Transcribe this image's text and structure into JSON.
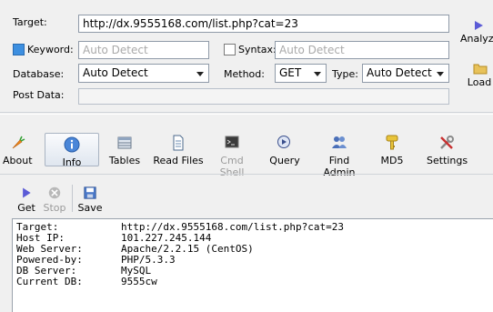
{
  "form": {
    "target_label": "Target:",
    "target_value": "http://dx.9555168.com/list.php?cat=23",
    "keyword_label": "Keyword:",
    "keyword_placeholder": "Auto Detect",
    "syntax_label": "Syntax:",
    "syntax_placeholder": "Auto Detect",
    "database_label": "Database:",
    "database_value": "Auto Detect",
    "method_label": "Method:",
    "method_value": "GET",
    "type_label": "Type:",
    "type_value": "Auto Detect",
    "postdata_label": "Post Data:"
  },
  "side_buttons": {
    "analyze": "Analyze",
    "load": "Load"
  },
  "tabs": [
    {
      "label": "About",
      "icon": "carrot-icon"
    },
    {
      "label": "Info",
      "icon": "info-icon"
    },
    {
      "label": "Tables",
      "icon": "table-icon"
    },
    {
      "label": "Read Files",
      "icon": "file-icon"
    },
    {
      "label": "Cmd Shell",
      "icon": "console-icon"
    },
    {
      "label": "Query",
      "icon": "query-icon"
    },
    {
      "label": "Find Admin",
      "icon": "users-icon"
    },
    {
      "label": "MD5",
      "icon": "key-icon"
    },
    {
      "label": "Settings",
      "icon": "tools-icon"
    }
  ],
  "toolbar": {
    "get": "Get",
    "stop": "Stop",
    "save": "Save"
  },
  "results": [
    {
      "key": "Target:",
      "value": "http://dx.9555168.com/list.php?cat=23"
    },
    {
      "key": "Host IP:",
      "value": "101.227.245.144"
    },
    {
      "key": "Web Server:",
      "value": "Apache/2.2.15 (CentOS)"
    },
    {
      "key": "Powered-by:",
      "value": "PHP/5.3.3"
    },
    {
      "key": "DB Server:",
      "value": "MySQL"
    },
    {
      "key": "Current DB:",
      "value": "9555cw"
    }
  ],
  "colors": {
    "accent": "#3d8fe0",
    "border": "#8f9aa8"
  }
}
